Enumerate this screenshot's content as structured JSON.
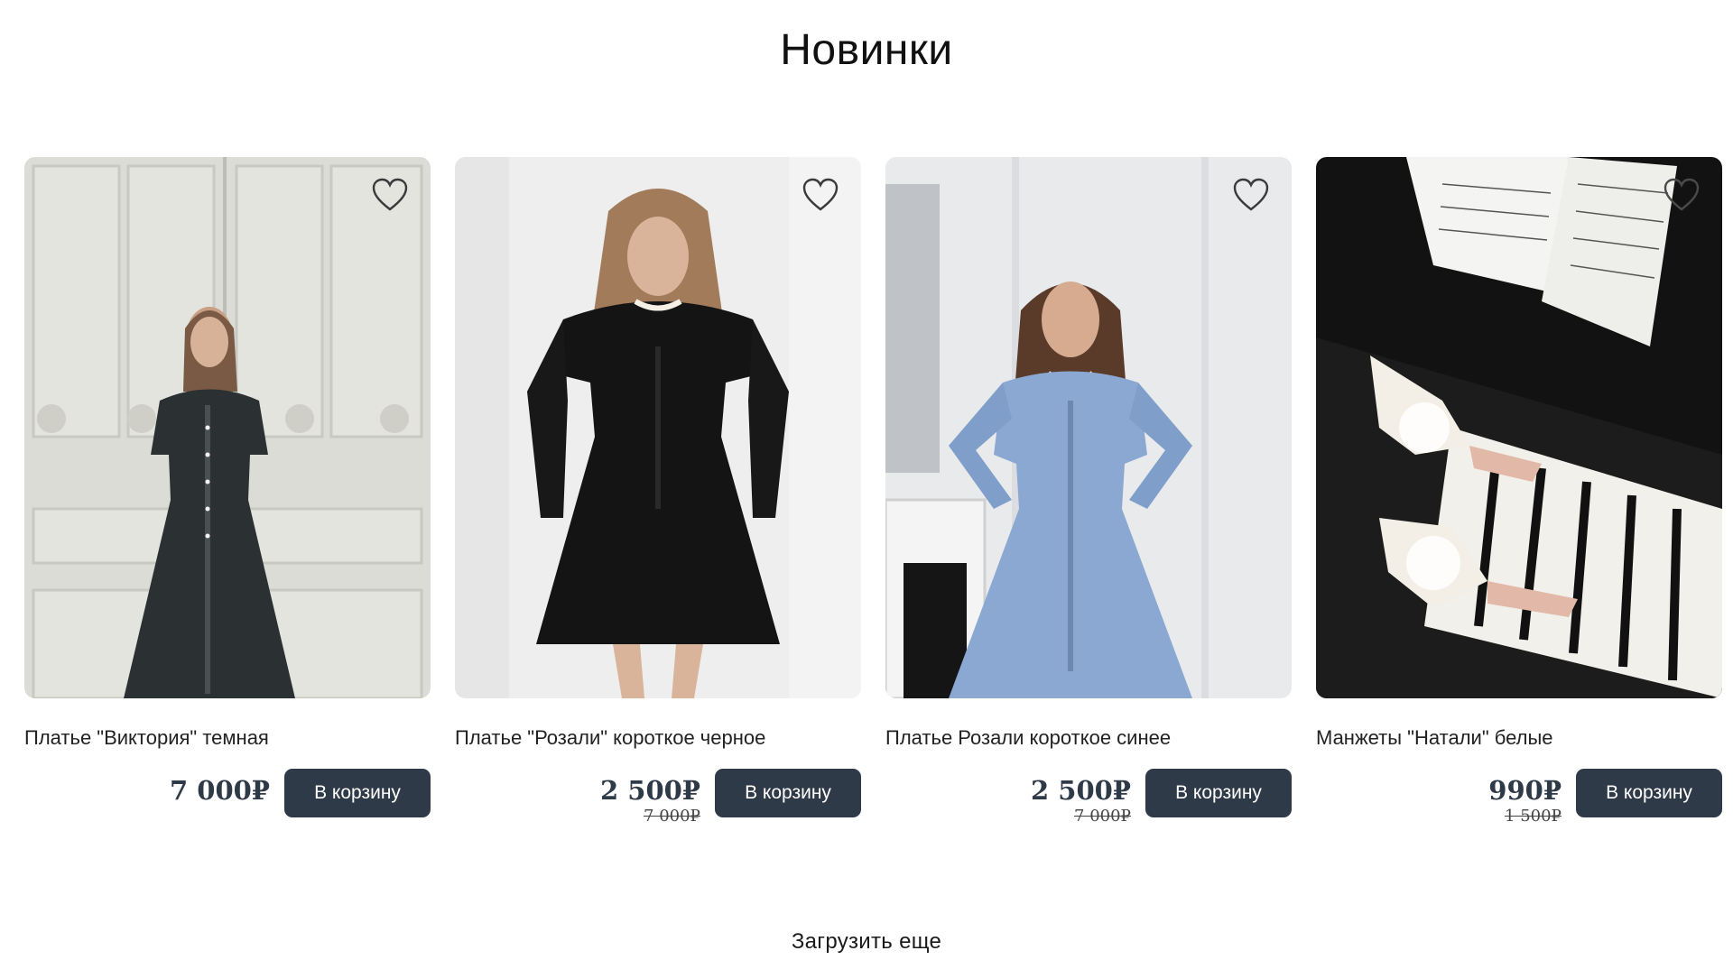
{
  "section": {
    "title": "Новинки"
  },
  "products": [
    {
      "name": "Платье \"Виктория\" темная",
      "price": "7 000₽",
      "old_price": "",
      "cart_label": "В корзину"
    },
    {
      "name": "Платье \"Розали\" короткое черное",
      "price": "2 500₽",
      "old_price": "7 000₽",
      "cart_label": "В корзину"
    },
    {
      "name": "Платье Розали короткое синее",
      "price": "2 500₽",
      "old_price": "7 000₽",
      "cart_label": "В корзину"
    },
    {
      "name": "Манжеты \"Натали\" белые",
      "price": "990₽",
      "old_price": "1 500₽",
      "cart_label": "В корзину"
    }
  ],
  "load_more": {
    "label": "Загрузить еще"
  },
  "colors": {
    "button_bg": "#2f3a48",
    "price_text": "#2f3a48",
    "button_text": "#ffffff"
  },
  "icons": {
    "favorite": "heart-outline-icon"
  }
}
